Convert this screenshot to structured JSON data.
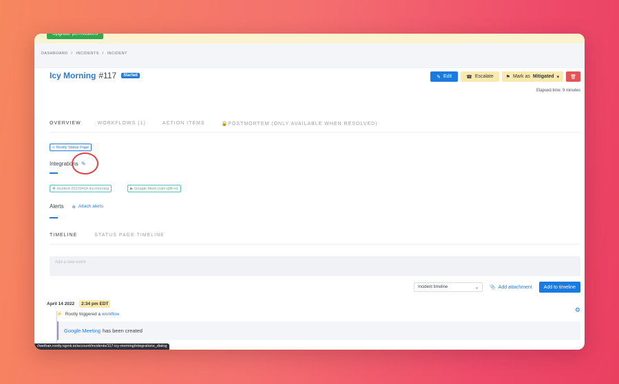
{
  "banner": {
    "upgrade_label": "Upgrade permissions"
  },
  "breadcrumb": [
    "DASHBOARD",
    "INCIDENTS",
    "INCIDENT"
  ],
  "incident": {
    "name": "Icy Morning",
    "number": "#117",
    "status": "Started"
  },
  "actions": {
    "edit": "Edit",
    "escalate": "Escalate",
    "mitigate_prefix": "Mark as",
    "mitigate_value": "Mitigated"
  },
  "elapsed": "Elapsed time: 9 minutes",
  "tabs": [
    "OVERVIEW",
    "WORKFLOWS (1)",
    "ACTION ITEMS",
    "POSTMORTEM (ONLY AVAILABLE WHEN RESOLVED)"
  ],
  "status_page_chip": "Rootly Status Page",
  "integrations": {
    "label": "Integrations",
    "chips": [
      "incident-20220414-icy-morning",
      "Google Meet (zgm-qBf-ni)"
    ]
  },
  "alerts": {
    "label": "Alerts",
    "attach_label": "Attach alerts"
  },
  "timeline_tabs": [
    "TIMELINE",
    "STATUS PAGE TIMELINE"
  ],
  "event_placeholder": "Add a new event",
  "timeline_controls": {
    "select_value": "Incident timeline",
    "add_attachment": "Add attachment",
    "add_to_timeline": "Add to timeline"
  },
  "timeline": {
    "date": "April 14 2022",
    "time": "2:34 pm EDT",
    "trigger_prefix": "Rootly triggered a",
    "trigger_link": "workflow",
    "card_link": "Google Meeting",
    "card_text": "has been created"
  },
  "status_url": "//weihan.rootly.ngrok.io/account/incidents/117-icy-morning/integrations_dialog",
  "colors": {
    "primary": "#1a7ae0",
    "warning": "#fbe9ad",
    "danger": "#e55353",
    "highlight_circle": "#e04343"
  }
}
